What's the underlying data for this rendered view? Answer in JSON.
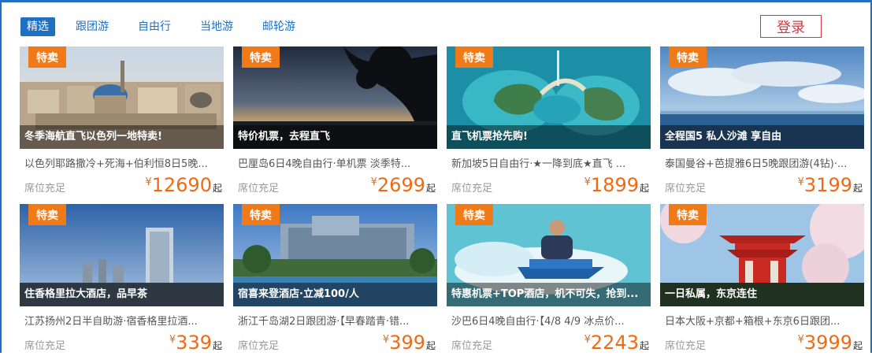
{
  "tabs": [
    "精选",
    "跟团游",
    "自由行",
    "当地游",
    "邮轮游"
  ],
  "login_label": "登录",
  "badge_label": "特卖",
  "currency_symbol": "¥",
  "price_suffix": "起",
  "cards": [
    {
      "caption": "冬季海航直飞以色列一地特卖!",
      "description": "以色列耶路撒冷+死海+伯利恒8日5晚...",
      "seat": "席位充足",
      "price": "12690"
    },
    {
      "caption": "特价机票，去程直飞",
      "description": "巴厘岛6日4晚自由行·单机票 淡季特...",
      "seat": "席位充足",
      "price": "2699"
    },
    {
      "caption": "直飞机票抢先购!",
      "description": "新加坡5日自由行·★一降到底★直飞 ...",
      "seat": "席位充足",
      "price": "1899"
    },
    {
      "caption": "全程国5 私人沙滩 享自由",
      "description": "泰国曼谷+芭提雅6日5晚跟团游(4钻)·...",
      "seat": "席位充足",
      "price": "3199"
    },
    {
      "caption": "住香格里拉大酒店，品早茶",
      "description": "江苏扬州2日半自助游·宿香格里拉酒...",
      "seat": "席位充足",
      "price": "339"
    },
    {
      "caption": "宿喜来登酒店·立减100/人",
      "description": "浙江千岛湖2日跟团游·【早春踏青·错...",
      "seat": "席位充足",
      "price": "399"
    },
    {
      "caption": "特惠机票+TOP酒店，机不可失，抢到...",
      "description": "沙巴6日4晚自由行·【4/8 4/9 冰点价...",
      "seat": "席位充足",
      "price": "2243"
    },
    {
      "caption": "一日私属，东京连住",
      "description": "日本大阪+京都+箱根+东京6日跟团...",
      "seat": "席位充足",
      "price": "3999"
    }
  ]
}
